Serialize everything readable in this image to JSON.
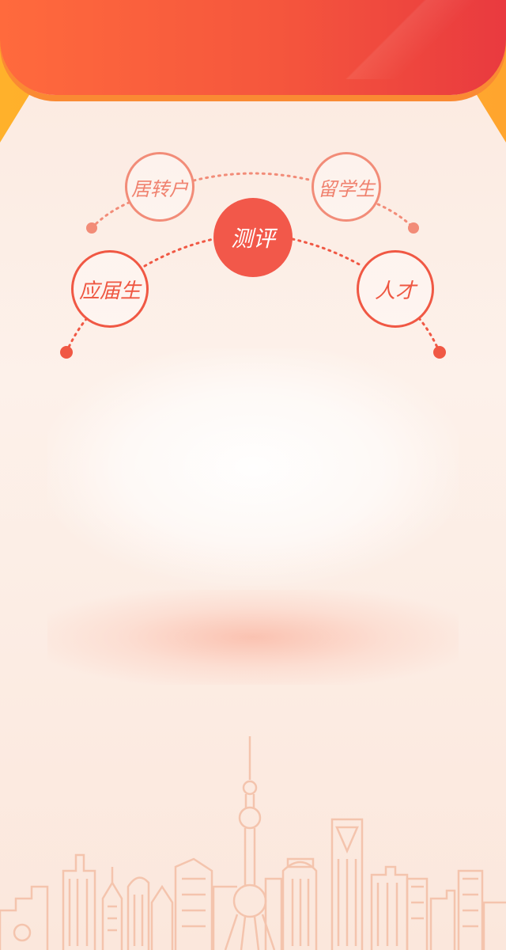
{
  "colors": {
    "banner_red": "#f5563d",
    "frame_orange": "#ffa52e",
    "accent_light": "#f28c78",
    "accent_strong": "#f05844",
    "skyline": "#f4c4ad"
  },
  "diagram": {
    "center_label": "测评",
    "top_left_label": "居转户",
    "top_right_label": "留学生",
    "bottom_left_label": "应届生",
    "bottom_right_label": "人才"
  }
}
